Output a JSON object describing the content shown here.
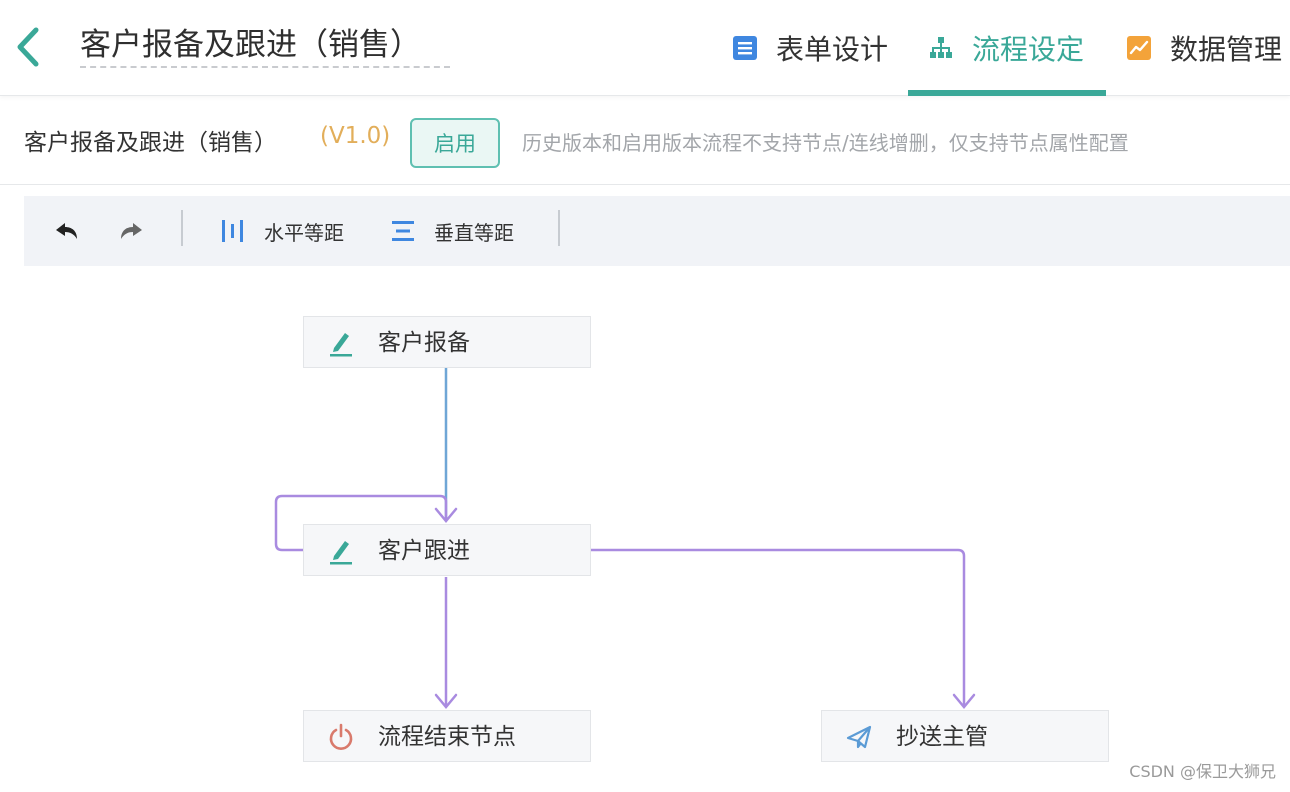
{
  "header": {
    "title": "客户报备及跟进（销售）",
    "tabs": [
      {
        "label": "表单设计",
        "icon": "form-icon",
        "color": "#3f87e0"
      },
      {
        "label": "流程设定",
        "icon": "flow-tree-icon",
        "active": true,
        "color": "#3aa898"
      },
      {
        "label": "数据管理",
        "icon": "chart-icon",
        "color": "#f3a33a"
      }
    ]
  },
  "version_bar": {
    "flow_name": "客户报备及跟进（销售）",
    "version": "(V1.0)",
    "enable_button": "启用",
    "note": "历史版本和启用版本流程不支持节点/连线增删，仅支持节点属性配置"
  },
  "toolbar": {
    "undo_icon": "undo-icon",
    "redo_icon": "redo-icon",
    "horizontal_label": "水平等距",
    "vertical_label": "垂直等距"
  },
  "flow": {
    "nodes": [
      {
        "label": "客户报备",
        "icon": "edit-icon"
      },
      {
        "label": "客户跟进",
        "icon": "edit-icon"
      },
      {
        "label": "流程结束节点",
        "icon": "power-icon"
      },
      {
        "label": "抄送主管",
        "icon": "send-icon"
      }
    ],
    "edge_colors": {
      "first": "#6fa6d6",
      "other": "#a98be0"
    }
  },
  "watermark": "CSDN @保卫大狮兄",
  "colors": {
    "accent": "#3aa898",
    "version": "#e2ae5a"
  }
}
